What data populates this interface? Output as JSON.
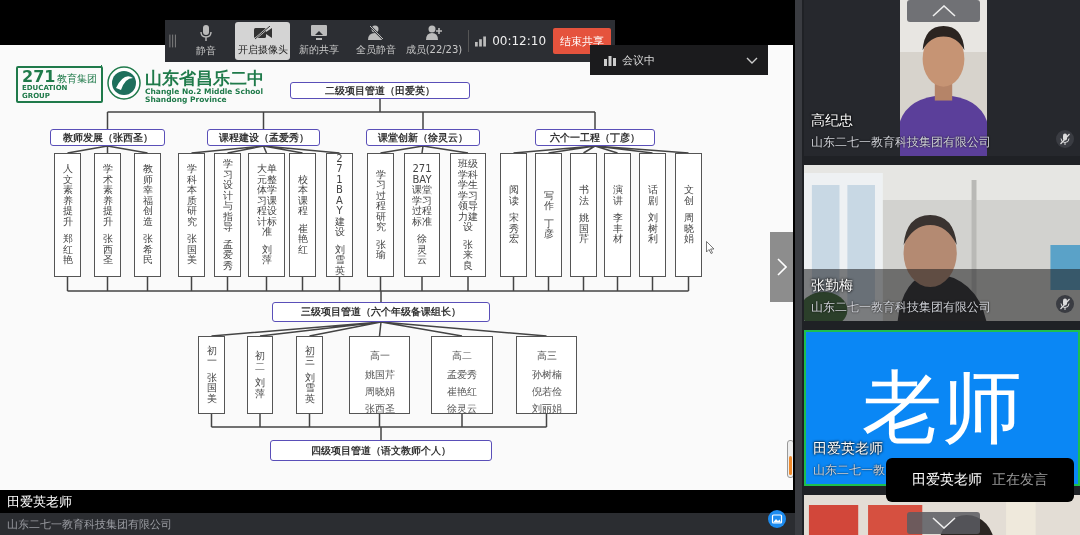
{
  "toolbar": {
    "items": [
      {
        "kind": "mic",
        "label": "静音",
        "selected": false
      },
      {
        "kind": "camera",
        "label": "开启摄像头",
        "selected": true
      },
      {
        "kind": "share",
        "label": "新的共享",
        "selected": false
      },
      {
        "kind": "mute-all",
        "label": "全员静音",
        "selected": false
      },
      {
        "kind": "members",
        "label": "成员(22/23)",
        "selected": false
      }
    ],
    "timer": "00:12:10",
    "end_button": "结束共享"
  },
  "meeting_status": {
    "label": "会议中"
  },
  "slide": {
    "logo": {
      "number": "271",
      "group_cn": "教育集团",
      "group_en": "EDUCATION GROUP"
    },
    "school_name": "山东省昌乐二中",
    "school_name_en": "Changle No.2 Middle School Shandong Province",
    "org_chart": {
      "title": "二级项目管道（田爱英）",
      "groups": [
        {
          "label": "教师发展（张西圣）",
          "children": [
            {
              "topic": "人文素养提升",
              "name": "郑红艳"
            },
            {
              "topic": "学术素养提升",
              "name": "张西圣"
            },
            {
              "topic": "教师幸福创造",
              "name": "张希民"
            }
          ]
        },
        {
          "label": "课程建设（孟爱秀）",
          "children": [
            {
              "topic": "学科本质研究",
              "name": "张国美"
            },
            {
              "topic": "学习设计与指导",
              "name": "孟爱秀"
            },
            {
              "topic": "大单元整体学习课程设计标准",
              "name": "刘萍"
            },
            {
              "topic": "校本课程",
              "name": "崔艳红"
            },
            {
              "topic": "271BAY建设",
              "name": "刘雪英"
            }
          ]
        },
        {
          "label": "课堂创新（徐灵云）",
          "children": [
            {
              "topic": "学习过程研究",
              "name": "张瑜"
            },
            {
              "topic": "271BAY课堂学习过程标准",
              "name": "徐灵云"
            },
            {
              "topic": "班级学科学生学习领导力建设",
              "name": "张来良"
            }
          ]
        },
        {
          "label": "六个一工程（丁彦）",
          "children": [
            {
              "topic": "阅读",
              "name": "宋秀宏"
            },
            {
              "topic": "写作",
              "name": "丁彦"
            },
            {
              "topic": "书法",
              "name": "姚国芹"
            },
            {
              "topic": "演讲",
              "name": "李丰材"
            },
            {
              "topic": "话剧",
              "name": "刘树利"
            },
            {
              "topic": "文创",
              "name": "周晓娟"
            }
          ]
        }
      ],
      "level3": {
        "label": "三级项目管道（六个年级备课组长）",
        "children": [
          {
            "grade": "初一",
            "names": [
              "张国美"
            ]
          },
          {
            "grade": "初二",
            "names": [
              "刘萍"
            ]
          },
          {
            "grade": "初三",
            "names": [
              "刘雪英"
            ]
          },
          {
            "grade": "高一",
            "names": [
              "姚国芹",
              "周晓娟",
              "张西圣"
            ]
          },
          {
            "grade": "高二",
            "names": [
              "孟爱秀",
              "崔艳红",
              "徐灵云"
            ]
          },
          {
            "grade": "高三",
            "names": [
              "孙树楠",
              "倪若俭",
              "刘丽娟"
            ]
          }
        ]
      },
      "level4": "四级项目管道（语文教师个人）"
    }
  },
  "presenter": {
    "name": "田爱英老师",
    "org": "山东二七一教育科技集团有限公司"
  },
  "participants": [
    {
      "kind": "portrait-video",
      "name": "高纪忠",
      "org": "山东二七一教育科技集团有限公司",
      "muted": true,
      "speaking": false
    },
    {
      "kind": "video",
      "name": "张勤梅",
      "org": "山东二七一教育科技集团有限公司",
      "muted": true,
      "speaking": false
    },
    {
      "kind": "avatar",
      "avatar_text": "老师",
      "name": "田爱英老师",
      "org": "山东二七一教",
      "speaking": true
    },
    {
      "kind": "video"
    }
  ],
  "speaking_toast": {
    "name": "田爱英老师",
    "status": "正在发言"
  }
}
